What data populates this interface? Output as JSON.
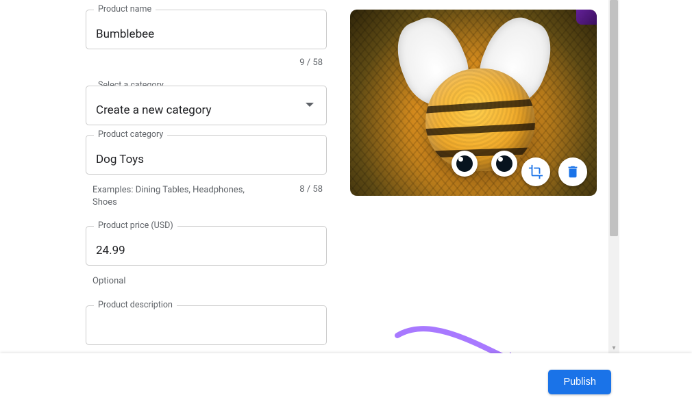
{
  "fields": {
    "name": {
      "label": "Product name",
      "value": "Bumblebee",
      "counter": "9 / 58"
    },
    "category_select": {
      "label": "Select a category",
      "value": "Create a new category"
    },
    "category": {
      "label": "Product category",
      "value": "Dog Toys",
      "helper": "Examples: Dining Tables, Headphones, Shoes",
      "counter": "8 / 58"
    },
    "price": {
      "label": "Product price (USD)",
      "value": "24.99",
      "helper": "Optional"
    },
    "description": {
      "label": "Product description"
    }
  },
  "image": {
    "crop_label": "Crop",
    "delete_label": "Delete"
  },
  "footer": {
    "publish_label": "Publish"
  }
}
